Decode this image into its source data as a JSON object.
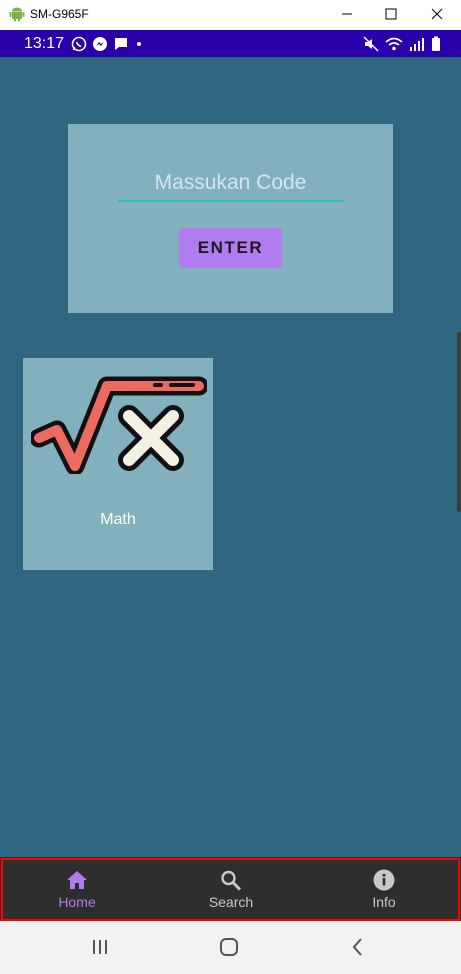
{
  "window": {
    "title": "SM-G965F"
  },
  "status_bar": {
    "time": "13:17"
  },
  "code_card": {
    "placeholder": "Massukan Code",
    "enter_label": "ENTER"
  },
  "subjects": [
    {
      "label": "Math",
      "icon": "square-root-x-icon"
    }
  ],
  "bottom_nav": {
    "items": [
      {
        "label": "Home",
        "icon": "home-icon",
        "active": true
      },
      {
        "label": "Search",
        "icon": "search-icon",
        "active": false
      },
      {
        "label": "Info",
        "icon": "info-icon",
        "active": false
      }
    ]
  },
  "colors": {
    "app_background": "#2f6781",
    "card": "#83b0bd",
    "accent_purple": "#b17cf0",
    "input_underline": "#23c8b3",
    "status_bar": "#2a00aa",
    "nav_background": "#2e2e2e"
  }
}
